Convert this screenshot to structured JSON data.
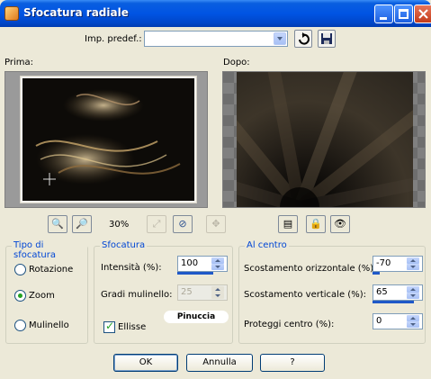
{
  "window": {
    "title": "Sfocatura radiale",
    "icons": {
      "app": "app-icon",
      "minimize": "minimize-icon",
      "maximize": "maximize-icon",
      "close": "close-icon"
    }
  },
  "preset": {
    "label": "Imp. predef.:",
    "value": "",
    "icons": {
      "reset": "reset-icon",
      "save": "save-icon"
    }
  },
  "preview": {
    "before_label": "Prima:",
    "after_label": "Dopo:",
    "zoom": "30%",
    "icons": {
      "zoom_out": "zoom-out-icon",
      "zoom_in": "zoom-in-icon",
      "fit": "fit-icon",
      "proof": "proof-icon",
      "pan": "pan-icon",
      "hide_preview": "hide-preview-icon",
      "lock": "lock-icon",
      "eye": "eye-icon"
    }
  },
  "blur_type": {
    "title": "Tipo di sfocatura",
    "options": [
      "Rotazione",
      "Zoom",
      "Mulinello"
    ],
    "selected": "Zoom"
  },
  "blur": {
    "title": "Sfocatura",
    "intensity_label": "Intensità (%):",
    "intensity_value": "100",
    "intensity_level": 1.0,
    "twist_label": "Gradi mulinello:",
    "twist_value": "25",
    "ellipse_label": "Ellisse",
    "ellipse_checked": true
  },
  "center": {
    "title": "Al centro",
    "h_offset_label": "Scostamento orizzontale (%):",
    "h_offset_value": "-70",
    "h_offset_level": 0.15,
    "v_offset_label": "Scostamento verticale (%):",
    "v_offset_value": "65",
    "v_offset_level": 0.82,
    "protect_label": "Proteggi centro (%):",
    "protect_value": "0",
    "protect_level": 0.0
  },
  "watermark": "Pinuccia",
  "buttons": {
    "ok": "OK",
    "cancel": "Annulla",
    "help": "?"
  },
  "colors": {
    "titlebar": "#0054e3",
    "dialog": "#ece9d8",
    "group_title": "#0046d5",
    "accent": "#1e58c8"
  }
}
